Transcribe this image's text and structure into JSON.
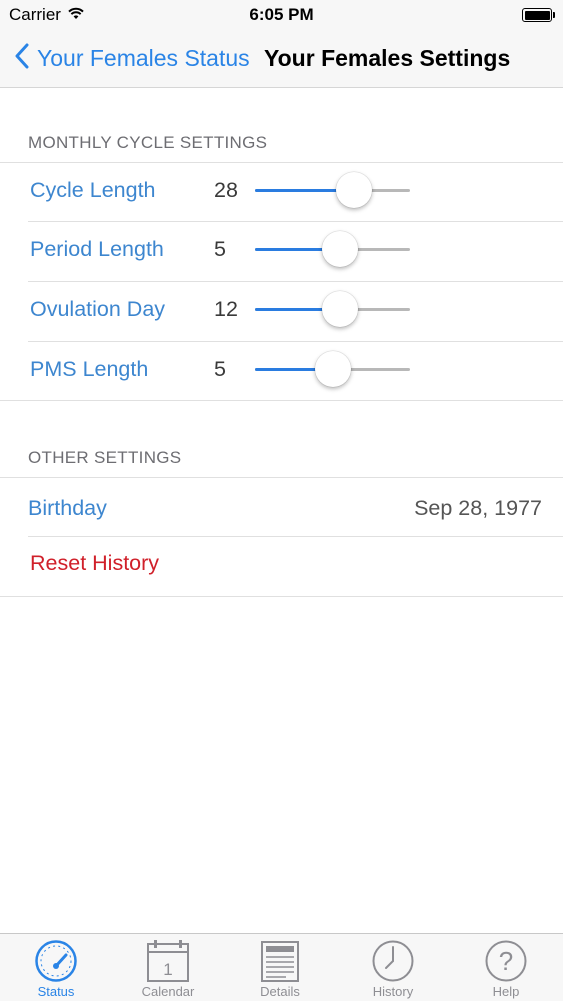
{
  "status_bar": {
    "carrier": "Carrier",
    "time": "6:05 PM"
  },
  "nav": {
    "back_label": "Your Females Status",
    "title": "Your Females Settings"
  },
  "monthly": {
    "header": "MONTHLY CYCLE SETTINGS",
    "rows": [
      {
        "label": "Cycle Length",
        "value": "28",
        "slider_fraction": 0.64
      },
      {
        "label": "Period Length",
        "value": "5",
        "slider_fraction": 0.55
      },
      {
        "label": "Ovulation Day",
        "value": "12",
        "slider_fraction": 0.55
      },
      {
        "label": "PMS Length",
        "value": "5",
        "slider_fraction": 0.5
      }
    ]
  },
  "other": {
    "header": "OTHER SETTINGS",
    "birthday_label": "Birthday",
    "birthday_value": "Sep 28, 1977",
    "reset_label": "Reset History"
  },
  "tabs": [
    {
      "label": "Status",
      "icon": "gauge-icon",
      "active": true
    },
    {
      "label": "Calendar",
      "icon": "calendar-icon",
      "active": false
    },
    {
      "label": "Details",
      "icon": "document-icon",
      "active": false
    },
    {
      "label": "History",
      "icon": "clock-icon",
      "active": false
    },
    {
      "label": "Help",
      "icon": "help-icon",
      "active": false
    }
  ],
  "colors": {
    "accent": "#2a84e6",
    "label_blue": "#3d86cf",
    "destructive": "#d0202a",
    "slider_fill": "#2a7ce0"
  }
}
